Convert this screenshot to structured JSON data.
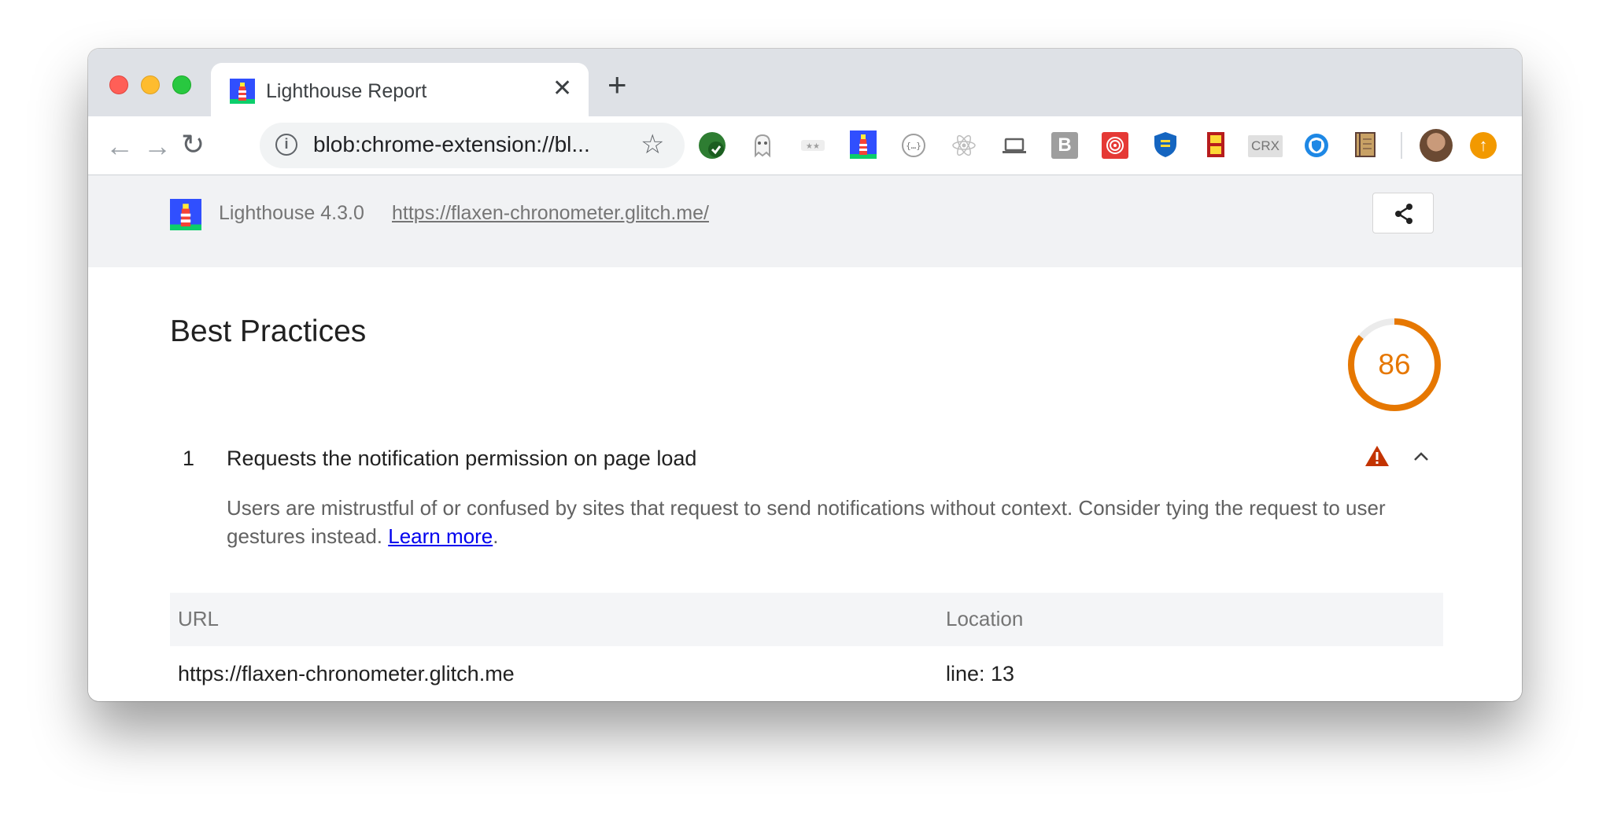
{
  "browser": {
    "tab_title": "Lighthouse Report",
    "tab_close": "✕",
    "new_tab": "+",
    "address": "blob:chrome-extension://bl...",
    "info_icon": "i",
    "star_icon": "☆",
    "back_icon": "←",
    "forward_icon": "→",
    "reload_icon": "↻",
    "extension_icons": [
      "check-extension-icon",
      "ghost-extension-icon",
      "rating-extension-icon",
      "lighthouse-extension-icon",
      "json-extension-icon",
      "react-extension-icon",
      "laptop-extension-icon",
      "b-extension-icon",
      "spiral-extension-icon",
      "shield-extension-icon",
      "sd-card-extension-icon",
      "crx-extension-icon",
      "privacy-extension-icon",
      "notebook-extension-icon"
    ],
    "crx_label": "CRX",
    "b_label": "B",
    "update_icon": "↑"
  },
  "lighthouse": {
    "version": "Lighthouse 4.3.0",
    "url": "https://flaxen-chronometer.glitch.me/"
  },
  "report": {
    "category_title": "Best Practices",
    "score": "86",
    "score_fraction": 0.86,
    "score_color": "#e67700",
    "audit": {
      "number": "1",
      "title": "Requests the notification permission on page load",
      "description": "Users are mistrustful of or confused by sites that request to send notifications without context. Consider tying the request to user gestures instead. ",
      "learn_more": "Learn more",
      "period": "."
    },
    "table": {
      "headers": [
        "URL",
        "Location"
      ],
      "rows": [
        [
          "https://flaxen-chronometer.glitch.me",
          "line: 13"
        ]
      ]
    }
  }
}
